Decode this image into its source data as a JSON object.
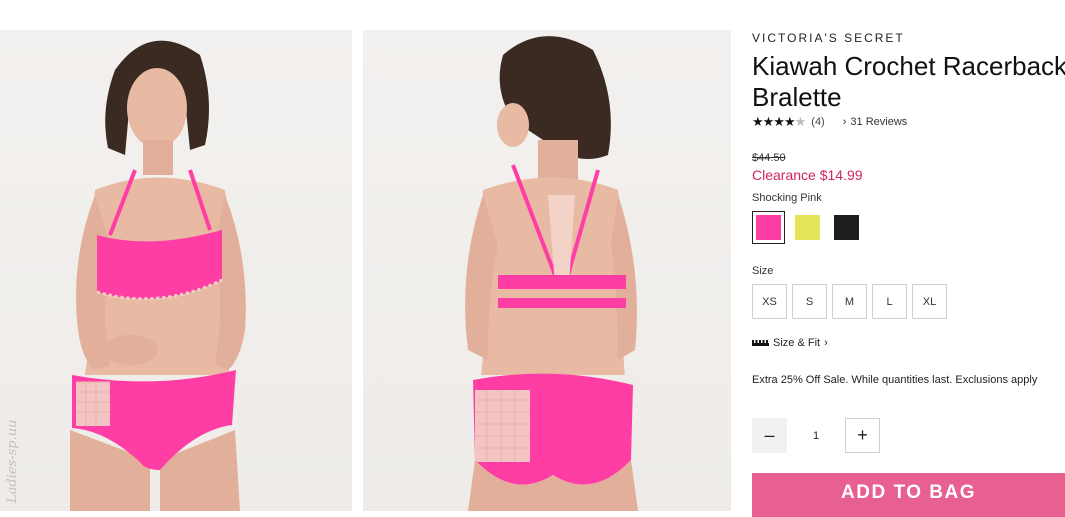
{
  "product": {
    "brand": "VICTORIA'S SECRET",
    "title": "Kiawah Crochet Racerback Bralette",
    "rating": 4,
    "rating_count": "(4)",
    "reviews_link": "31 Reviews",
    "original_price": "$44.50",
    "sale_price": "Clearance $14.99",
    "selected_color": "Shocking Pink",
    "swatches": [
      {
        "name": "Shocking Pink",
        "color": "#ff3ea5",
        "selected": true
      },
      {
        "name": "Yellow",
        "color": "#e4e45a",
        "selected": false
      },
      {
        "name": "Black",
        "color": "#1e1e1e",
        "selected": false
      }
    ],
    "size_label": "Size",
    "sizes": [
      "XS",
      "S",
      "M",
      "L",
      "XL"
    ],
    "size_fit_link": "Size & Fit",
    "promo": "Extra 25% Off Sale. While quantities last. Exclusions apply",
    "quantity": "1",
    "add_to_bag": "ADD TO BAG"
  },
  "images": {
    "watermark": "Ladies-sp.uu",
    "colors": {
      "garment": "#ff3ea5",
      "trim": "#f3d2c8",
      "skin": "#e8b9a3",
      "hair": "#3a2a22"
    }
  }
}
